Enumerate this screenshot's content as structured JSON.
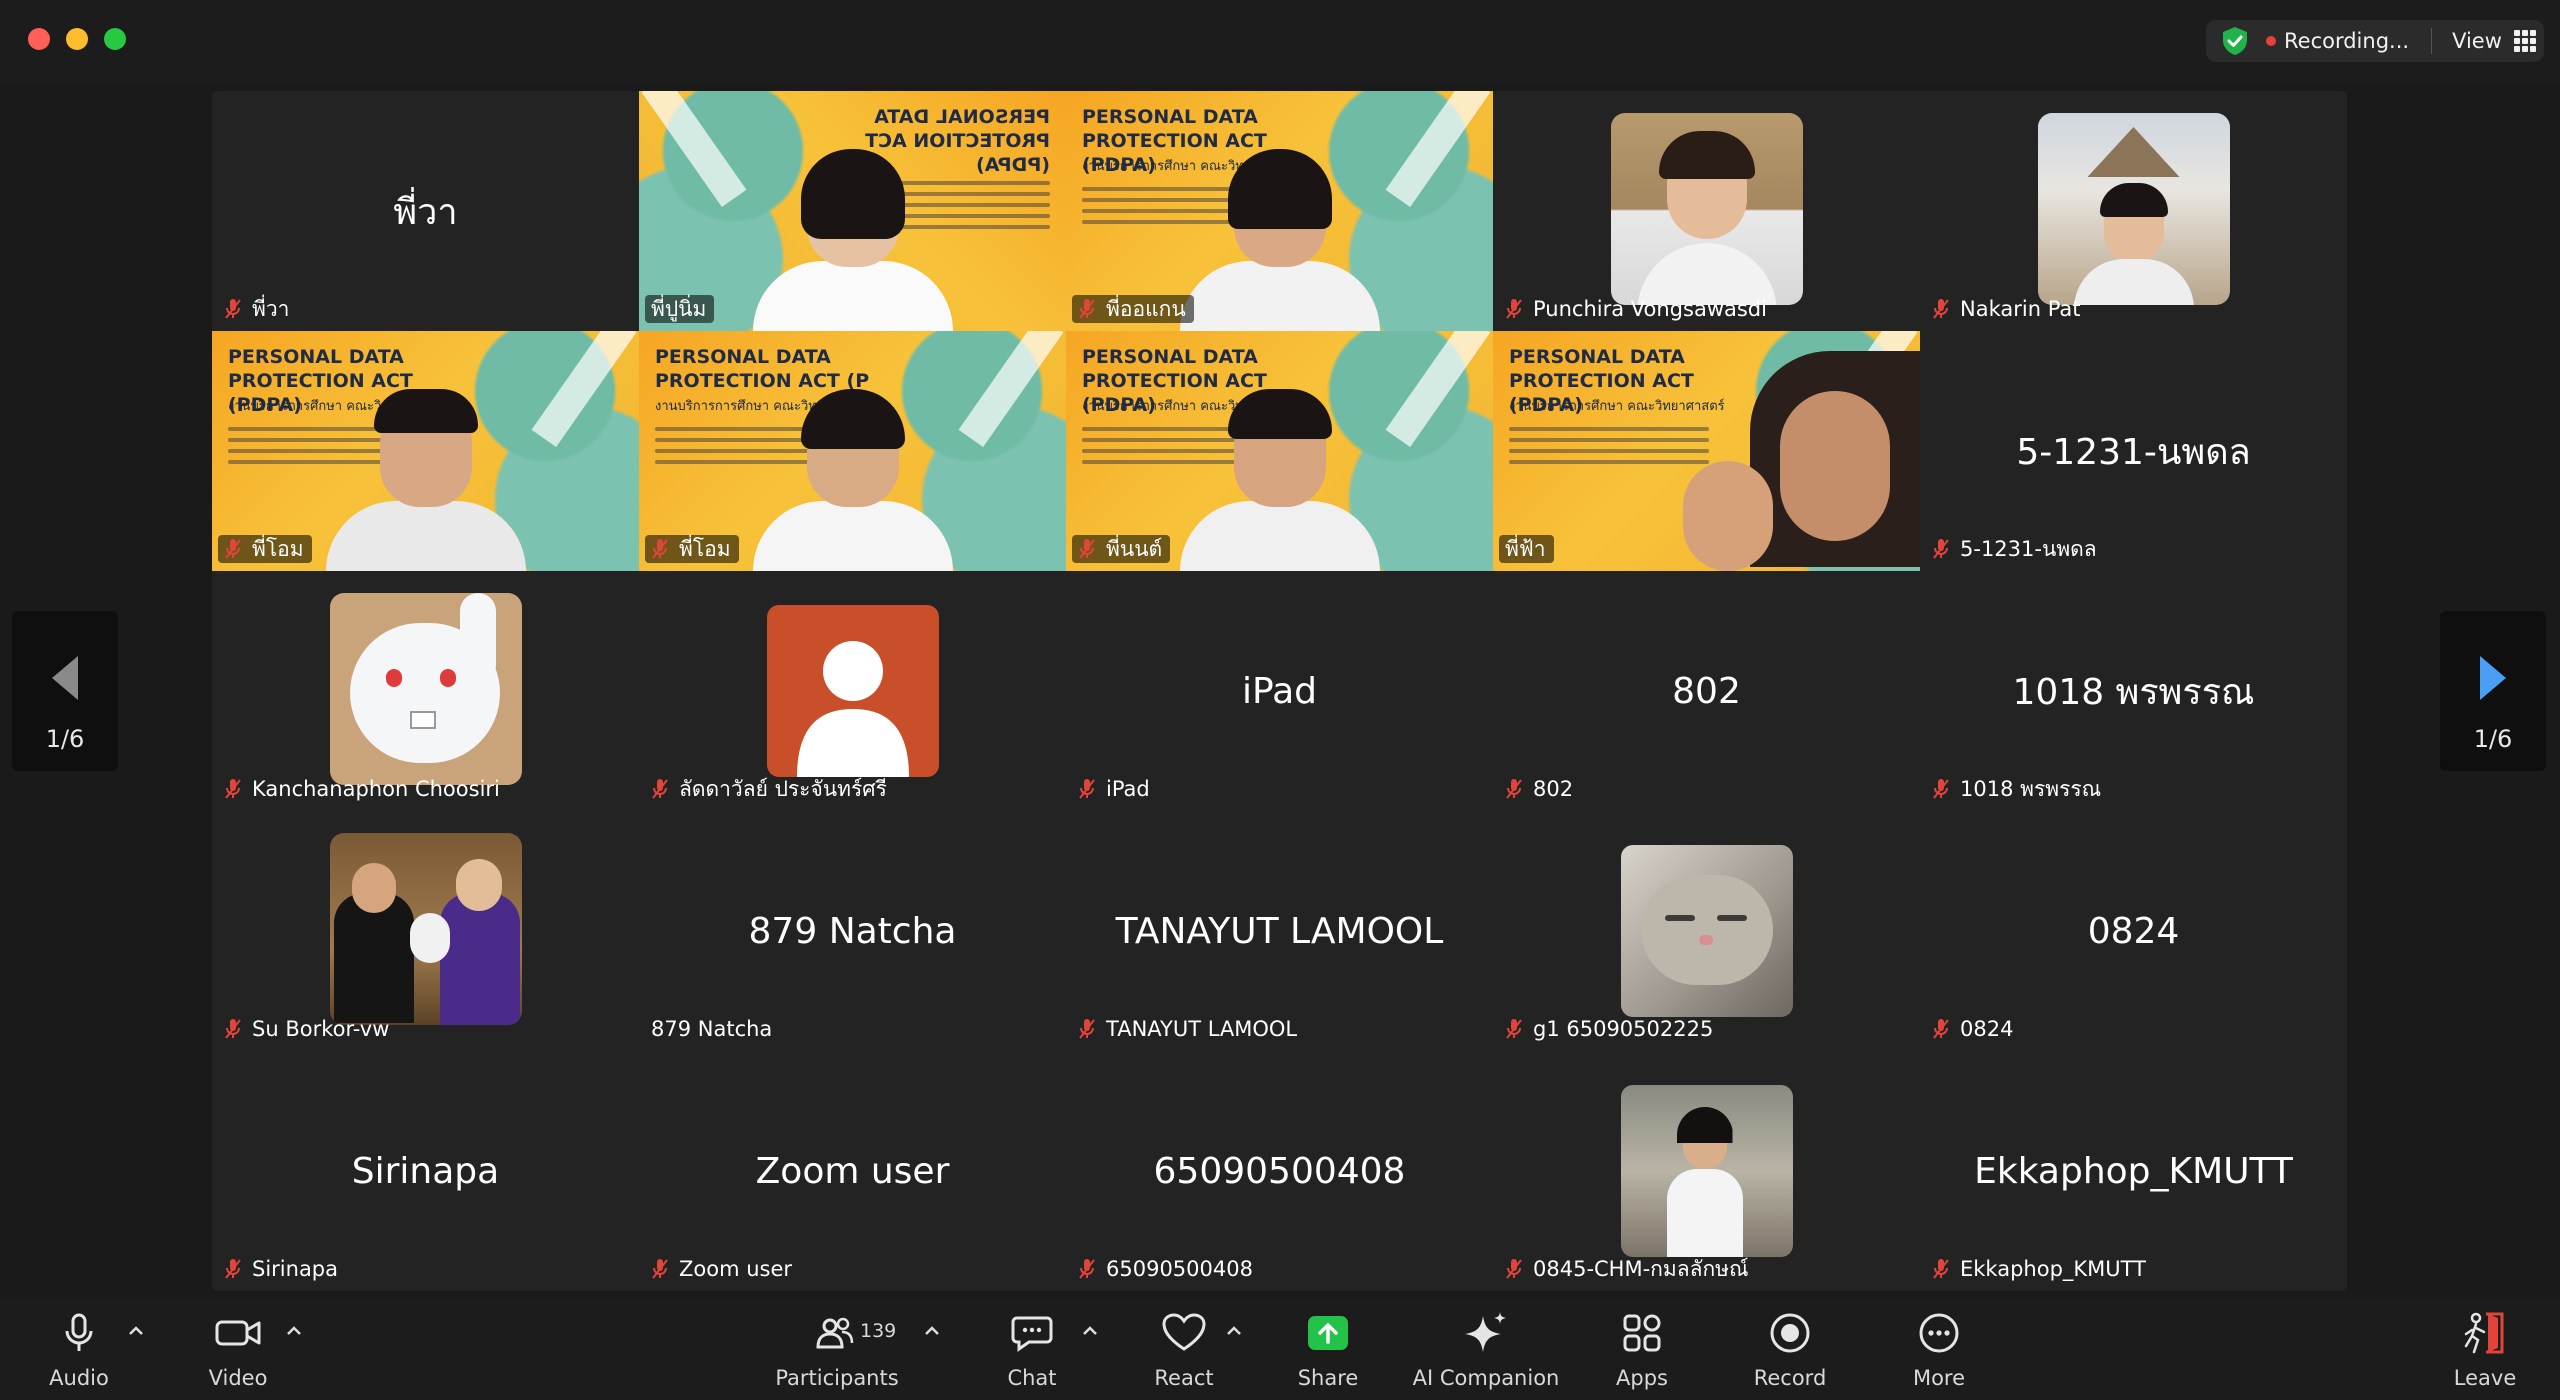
{
  "header": {
    "recording_label": "Recording...",
    "view_label": "View"
  },
  "pager": {
    "left_label": "1/6",
    "right_label": "1/6"
  },
  "tiles": [
    {
      "center": "พี่วา",
      "name": "พี่วา"
    },
    {
      "name": "พี่ปูนิ่ม",
      "slide_title_mirrored": "PERSONAL DATA PROTECTION ACT (PDPA)"
    },
    {
      "name": "พี่ออแกน",
      "slide_title": "PERSONAL DATA PROTECTION ACT (PDPA)",
      "slide_sub": "งานบริการการศึกษา คณะวิทยาศาสตร์"
    },
    {
      "name": "Punchira Vongsawasdi"
    },
    {
      "name": "Nakarin Pat"
    },
    {
      "name": "พี่โอม",
      "slide_title": "PERSONAL DATA PROTECTION ACT (PDPA)",
      "slide_sub": "งานบริการการศึกษา คณะวิทยาศาสตร์"
    },
    {
      "name": "พี่โอม",
      "slide_title": "PERSONAL DATA PROTECTION ACT (P",
      "slide_sub": "งานบริการการศึกษา คณะวิทยาศาสตร์"
    },
    {
      "name": "พี่นนต์",
      "slide_title": "PERSONAL DATA PROTECTION ACT (PDPA)",
      "slide_sub": "งานบริการการศึกษา คณะวิทยาศาสตร์"
    },
    {
      "name": "พี่ฟ้า",
      "slide_title": "PERSONAL DATA PROTECTION ACT (PDPA)",
      "slide_sub": "งานบริการการศึกษา คณะวิทยาศาสตร์"
    },
    {
      "center": "5-1231-นพดล",
      "name": "5-1231-นพดล"
    },
    {
      "name": "Kanchanaphon Choosiri"
    },
    {
      "name": "ลัดดาวัลย์ ประจันทร์ศรี"
    },
    {
      "center": "iPad",
      "name": "iPad"
    },
    {
      "center": "802",
      "name": "802"
    },
    {
      "center": "1018 พรพรรณ",
      "name": "1018 พรพรรณ"
    },
    {
      "name": "Su Borkor-vw"
    },
    {
      "center": "879 Natcha",
      "name": "879 Natcha"
    },
    {
      "center": "TANAYUT LAMOOL",
      "name": "TANAYUT LAMOOL"
    },
    {
      "name": "g1 65090502225"
    },
    {
      "center": "0824",
      "name": "0824"
    },
    {
      "center": "Sirinapa",
      "name": "Sirinapa"
    },
    {
      "center": "Zoom user",
      "name": "Zoom user"
    },
    {
      "center": "65090500408",
      "name": "65090500408"
    },
    {
      "name": "0845-CHM-กมลลักษณ์"
    },
    {
      "center": "Ekkaphop_KMUTT",
      "name": "Ekkaphop_KMUTT"
    }
  ],
  "toolbar": {
    "audio": "Audio",
    "video": "Video",
    "participants": "Participants",
    "participants_count": "139",
    "chat": "Chat",
    "react": "React",
    "share": "Share",
    "ai_companion": "AI Companion",
    "apps": "Apps",
    "record": "Record",
    "more": "More",
    "leave": "Leave"
  },
  "colors": {
    "background": "#1a1a1a",
    "tile": "#232323",
    "speaking_border": "#3fcf5c",
    "share_green": "#23c248",
    "recording_red": "#e8413b",
    "mute_red": "#e0443a",
    "pager_arrow_active": "#4a9ff5"
  }
}
